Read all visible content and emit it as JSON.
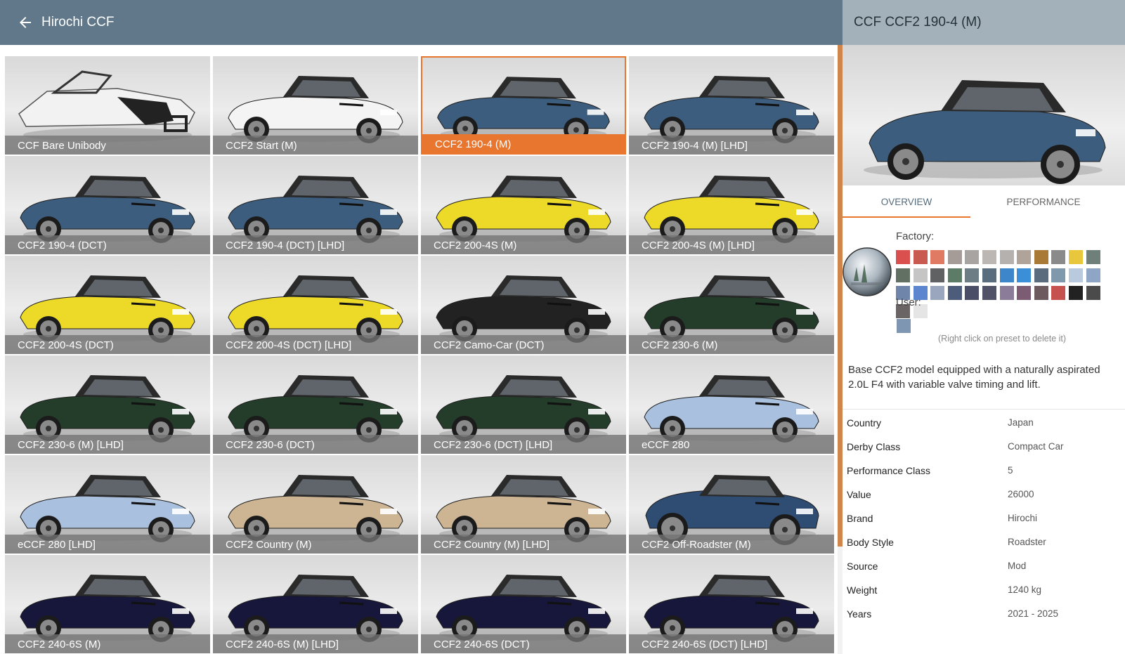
{
  "header": {
    "title": "Hirochi CCF"
  },
  "tiles": [
    {
      "label": "CCF Bare Unibody",
      "color": "#f2f2f2",
      "kind": "bare"
    },
    {
      "label": "CCF2 Start (M)",
      "color": "#f4f4f4",
      "kind": "car"
    },
    {
      "label": "CCF2 190-4 (M)",
      "color": "#3d5d7e",
      "kind": "car"
    },
    {
      "label": "CCF2 190-4 (M) [LHD]",
      "color": "#3d5d7e",
      "kind": "car"
    },
    {
      "label": "CCF2 190-4 (DCT)",
      "color": "#3d5d7e",
      "kind": "car"
    },
    {
      "label": "CCF2 190-4 (DCT) [LHD]",
      "color": "#3d5d7e",
      "kind": "car"
    },
    {
      "label": "CCF2 200-4S (M)",
      "color": "#ecd928",
      "kind": "car"
    },
    {
      "label": "CCF2 200-4S (M) [LHD]",
      "color": "#ecd928",
      "kind": "car"
    },
    {
      "label": "CCF2 200-4S (DCT)",
      "color": "#ecd928",
      "kind": "car"
    },
    {
      "label": "CCF2 200-4S (DCT) [LHD]",
      "color": "#ecd928",
      "kind": "car"
    },
    {
      "label": "CCF2 Camo-Car (DCT)",
      "color": "#222222",
      "kind": "car"
    },
    {
      "label": "CCF2 230-6 (M)",
      "color": "#233d2a",
      "kind": "car"
    },
    {
      "label": "CCF2 230-6 (M) [LHD]",
      "color": "#233d2a",
      "kind": "car"
    },
    {
      "label": "CCF2 230-6 (DCT)",
      "color": "#233d2a",
      "kind": "car"
    },
    {
      "label": "CCF2 230-6 (DCT) [LHD]",
      "color": "#233d2a",
      "kind": "car"
    },
    {
      "label": "eCCF 280",
      "color": "#a9c0df",
      "kind": "car"
    },
    {
      "label": "eCCF 280 [LHD]",
      "color": "#a9c0df",
      "kind": "car"
    },
    {
      "label": "CCF2 Country (M)",
      "color": "#cdb594",
      "kind": "car"
    },
    {
      "label": "CCF2 Country (M) [LHD]",
      "color": "#cdb594",
      "kind": "car"
    },
    {
      "label": "CCF2 Off-Roadster (M)",
      "color": "#2f4c73",
      "kind": "offroad"
    },
    {
      "label": "CCF2 240-6S (M)",
      "color": "#16173a",
      "kind": "car"
    },
    {
      "label": "CCF2 240-6S (M) [LHD]",
      "color": "#16173a",
      "kind": "car"
    },
    {
      "label": "CCF2 240-6S (DCT)",
      "color": "#16173a",
      "kind": "car"
    },
    {
      "label": "CCF2 240-6S (DCT) [LHD]",
      "color": "#16173a",
      "kind": "car"
    }
  ],
  "selected_index": 2,
  "panel": {
    "title": "CCF CCF2 190-4 (M)",
    "preview_color": "#3d5d7e",
    "tabs": [
      {
        "label": "OVERVIEW",
        "active": true
      },
      {
        "label": "PERFORMANCE",
        "active": false
      }
    ],
    "factory_label": "Factory:",
    "factory_swatches": [
      "#d9504f",
      "#c95a52",
      "#e07a63",
      "#a59c97",
      "#a8a4a2",
      "#bcb7b2",
      "#b4b1ae",
      "#b0a49a",
      "#a87a35",
      "#8a8a8a",
      "#e8c73d",
      "#6f7f7a",
      "#627063",
      "#c5c5c5",
      "#5f6162",
      "#5c7c68",
      "#6c7d86",
      "#5a6d7e",
      "#3c86c9",
      "#3b8fd8",
      "#5a6c7e",
      "#7f98ac",
      "#b9cadf",
      "#8fa5c6",
      "#6f85a9",
      "#5c87cf",
      "#9aa6bd",
      "#4c5c7a",
      "#4a4e66",
      "#505268",
      "#8b7c9a",
      "#7b5c72",
      "#6c5a5e",
      "#c6524f",
      "#222222",
      "#4b4b4b",
      "#6a6464",
      "#e5e5e5"
    ],
    "user_label": "User:",
    "user_swatches": [
      "#7f96b3"
    ],
    "hint": "(Right click on preset to delete it)",
    "description": "Base CCF2 model equipped with a naturally aspirated 2.0L F4 with variable valve timing and lift.",
    "info": [
      {
        "key": "Country",
        "value": "Japan"
      },
      {
        "key": "Derby Class",
        "value": "Compact Car"
      },
      {
        "key": "Performance Class",
        "value": "5"
      },
      {
        "key": "Value",
        "value": "26000"
      },
      {
        "key": "Brand",
        "value": "Hirochi"
      },
      {
        "key": "Body Style",
        "value": "Roadster"
      },
      {
        "key": "Source",
        "value": "Mod"
      },
      {
        "key": "Weight",
        "value": "1240 kg"
      },
      {
        "key": "Years",
        "value": "2021 - 2025"
      }
    ]
  },
  "colors": {
    "accent": "#e8762f",
    "topbar": "#607889",
    "panel_header": "#a3b1bb"
  }
}
